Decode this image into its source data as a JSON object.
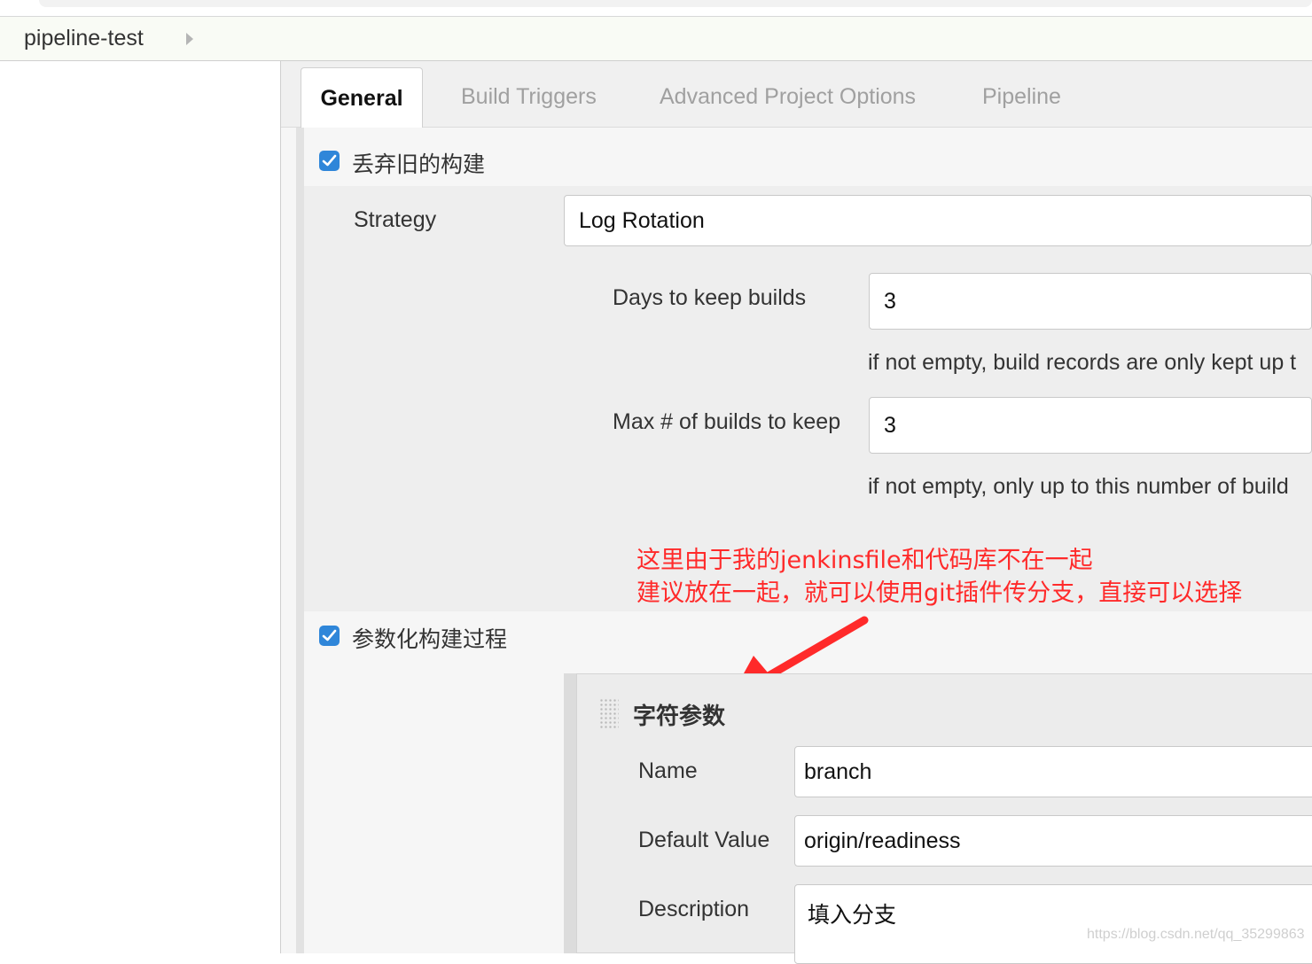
{
  "breadcrumb": {
    "item": "pipeline-test"
  },
  "tabs": [
    {
      "label": "General",
      "active": true
    },
    {
      "label": "Build Triggers"
    },
    {
      "label": "Advanced Project Options"
    },
    {
      "label": "Pipeline"
    }
  ],
  "discard_builds": {
    "checked": true,
    "label": "丢弃旧的构建",
    "strategy_label": "Strategy",
    "strategy_value": "Log Rotation",
    "days_label": "Days to keep builds",
    "days_value": "3",
    "days_help": "if not empty, build records are only kept up t",
    "max_label": "Max # of builds to keep",
    "max_value": "3",
    "max_help": "if not empty, only up to this number of build"
  },
  "annotation": {
    "line1": "这里由于我的jenkinsfile和代码库不在一起",
    "line2": "建议放在一起，就可以使用git插件传分支，直接可以选择",
    "color": "#ff2a2a"
  },
  "parameterized": {
    "checked": true,
    "label": "参数化构建过程",
    "param_title": "字符参数",
    "name_label": "Name",
    "name_value": "branch",
    "default_label": "Default Value",
    "default_value": "origin/readiness",
    "description_label": "Description",
    "description_value": "填入分支"
  },
  "watermark": "https://blog.csdn.net/qq_35299863",
  "colors": {
    "checkbox": "#2f86d9",
    "accent_red": "#ff2a2a"
  }
}
